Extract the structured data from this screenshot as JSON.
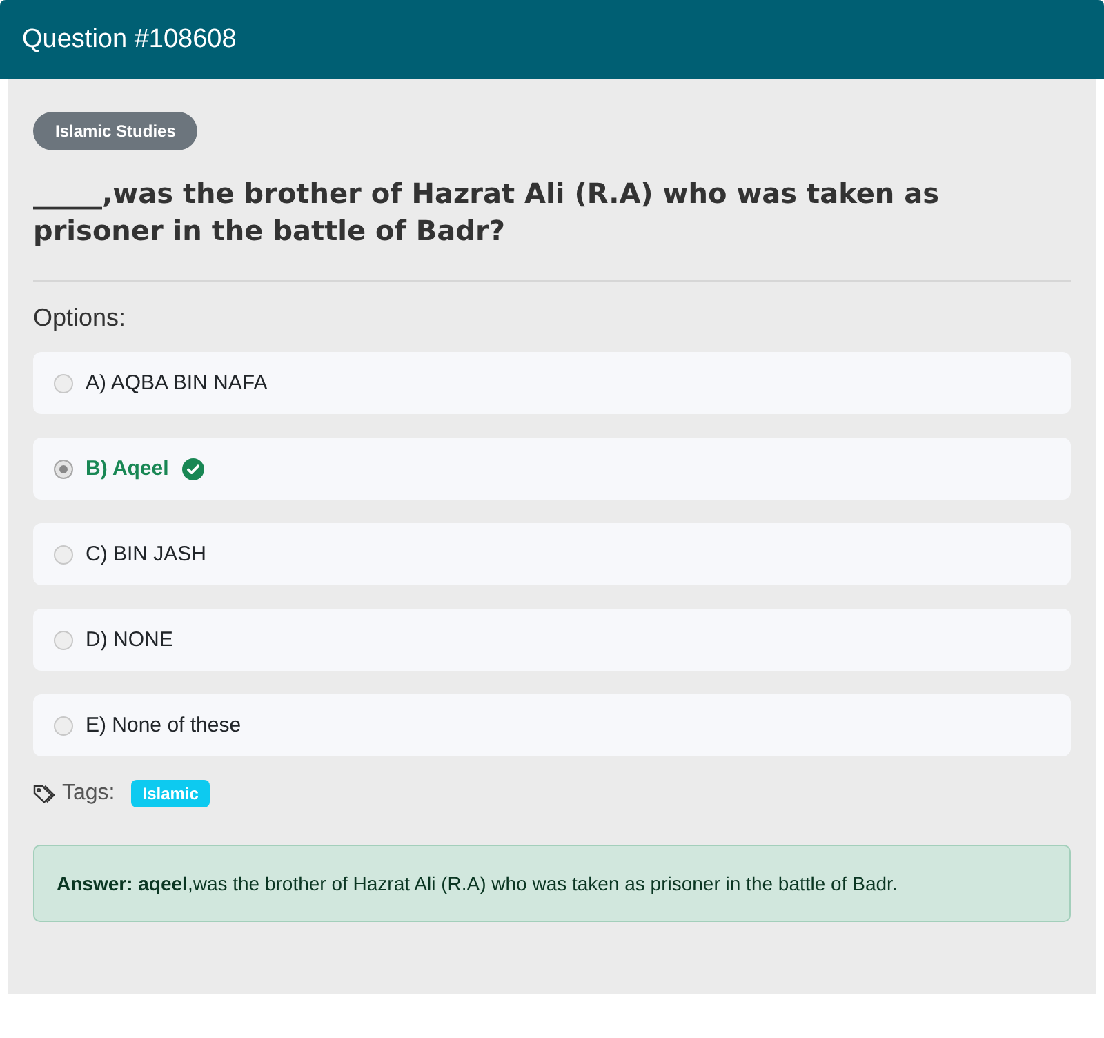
{
  "header": {
    "title": "Question #108608"
  },
  "category": "Islamic Studies",
  "question": "_____,was the brother of Hazrat Ali (R.A) who was taken as prisoner in the battle of Badr?",
  "options_label": "Options:",
  "options": [
    {
      "label": "A) AQBA BIN NAFA",
      "selected": false,
      "correct": false
    },
    {
      "label": "B) Aqeel",
      "selected": true,
      "correct": true
    },
    {
      "label": "C) BIN JASH",
      "selected": false,
      "correct": false
    },
    {
      "label": "D) NONE",
      "selected": false,
      "correct": false
    },
    {
      "label": "E) None of these",
      "selected": false,
      "correct": false
    }
  ],
  "tags_label": "Tags:",
  "tags": [
    "Islamic"
  ],
  "answer": "**Answer: aqeel**,was the brother of Hazrat Ali (R.A) who was taken as prisoner in the battle of Badr."
}
